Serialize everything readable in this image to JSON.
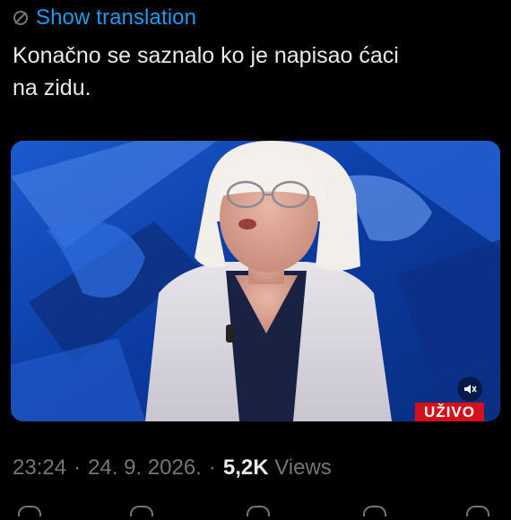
{
  "translation": {
    "label": "Show translation"
  },
  "tweet": {
    "text_line1": "Konačno se saznalo ko je napisao ćaci",
    "text_line2": "na zidu."
  },
  "media": {
    "live_badge": "UŽIVO",
    "mute_icon": "speaker-muted-icon"
  },
  "meta": {
    "time": "23:24",
    "date": "24. 9. 2026.",
    "views_count": "5,2K",
    "views_label": "Views"
  },
  "colors": {
    "accent": "#1d9bf0",
    "background": "#000000",
    "text": "#e7e9ea",
    "muted": "#71767b",
    "live_badge": "#d6101a"
  }
}
